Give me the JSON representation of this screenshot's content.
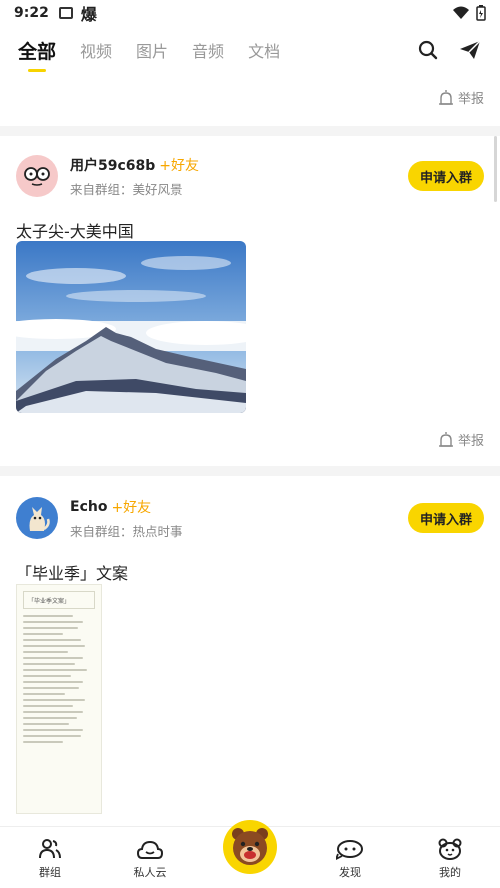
{
  "status_bar": {
    "time": "9:22",
    "extra_glyph": "爆"
  },
  "tabs": [
    {
      "label": "全部",
      "active": true
    },
    {
      "label": "视频",
      "active": false
    },
    {
      "label": "图片",
      "active": false
    },
    {
      "label": "音频",
      "active": false
    },
    {
      "label": "文档",
      "active": false
    }
  ],
  "report_label": "举报",
  "posts": [
    {
      "username": "用户59c68b",
      "add_friend": "+好友",
      "group": "来自群组：美好风景",
      "join_label": "申请入群",
      "title": "太子尖-大美中国"
    },
    {
      "username": "Echo",
      "add_friend": "+好友",
      "group": "来自群组：热点时事",
      "join_label": "申请入群",
      "title": "「毕业季」文案",
      "doc_heading": "「毕业季文案」"
    }
  ],
  "bottom_nav": {
    "groups": "群组",
    "cloud": "私人云",
    "discover": "发现",
    "mine": "我的"
  },
  "colors": {
    "accent": "#f9d500",
    "friend": "#f7a700"
  }
}
